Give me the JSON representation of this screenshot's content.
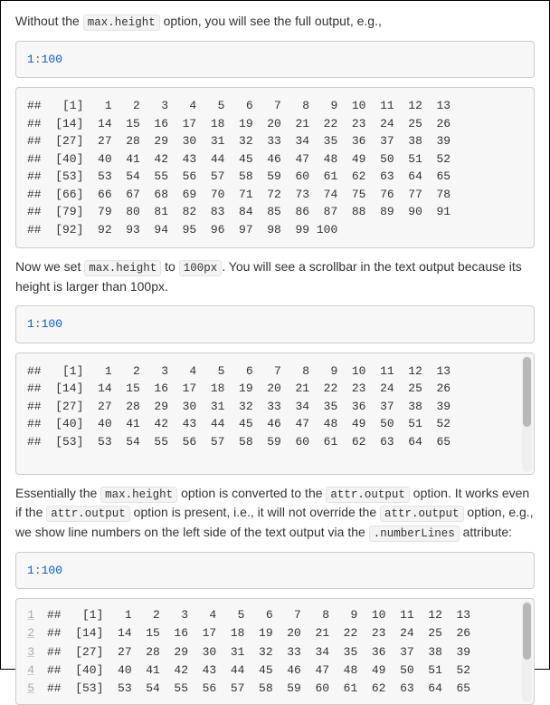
{
  "para1_prefix": "Without the ",
  "code_maxheight": "max.height",
  "para1_suffix": " option, you will see the full output, e.g.,",
  "code_expr_a": "1",
  "code_expr_colon": ":",
  "code_expr_b": "100",
  "output_full": "##   [1]   1   2   3   4   5   6   7   8   9  10  11  12  13\n##  [14]  14  15  16  17  18  19  20  21  22  23  24  25  26\n##  [27]  27  28  29  30  31  32  33  34  35  36  37  38  39\n##  [40]  40  41  42  43  44  45  46  47  48  49  50  51  52\n##  [53]  53  54  55  56  57  58  59  60  61  62  63  64  65\n##  [66]  66  67  68  69  70  71  72  73  74  75  76  77  78\n##  [79]  79  80  81  82  83  84  85  86  87  88  89  90  91\n##  [92]  92  93  94  95  96  97  98  99 100",
  "para2_a": "Now we set ",
  "para2_b": " to ",
  "code_100px": "100px",
  "para2_c": ". You will see a scrollbar in the text output because its height is larger than 100px.",
  "output_limited": "##   [1]   1   2   3   4   5   6   7   8   9  10  11  12  13\n##  [14]  14  15  16  17  18  19  20  21  22  23  24  25  26\n##  [27]  27  28  29  30  31  32  33  34  35  36  37  38  39\n##  [40]  40  41  42  43  44  45  46  47  48  49  50  51  52\n##  [53]  53  54  55  56  57  58  59  60  61  62  63  64  65",
  "para3_a": "Essentially the ",
  "para3_b": " option is converted to the ",
  "code_attroutput": "attr.output",
  "para3_c": " option. It works even if the ",
  "para3_d": " option is present, i.e., it will not override the ",
  "para3_e": " option, e.g., we show line numbers on the left side of the text output via the ",
  "code_numberlines": ".numberLines",
  "para3_f": " attribute:",
  "numbered_rows": [
    "##   [1]   1   2   3   4   5   6   7   8   9  10  11  12  13",
    "##  [14]  14  15  16  17  18  19  20  21  22  23  24  25  26",
    "##  [27]  27  28  29  30  31  32  33  34  35  36  37  38  39",
    "##  [40]  40  41  42  43  44  45  46  47  48  49  50  51  52",
    "##  [53]  53  54  55  56  57  58  59  60  61  62  63  64  65"
  ],
  "ln": [
    "1",
    "2",
    "3",
    "4",
    "5"
  ]
}
